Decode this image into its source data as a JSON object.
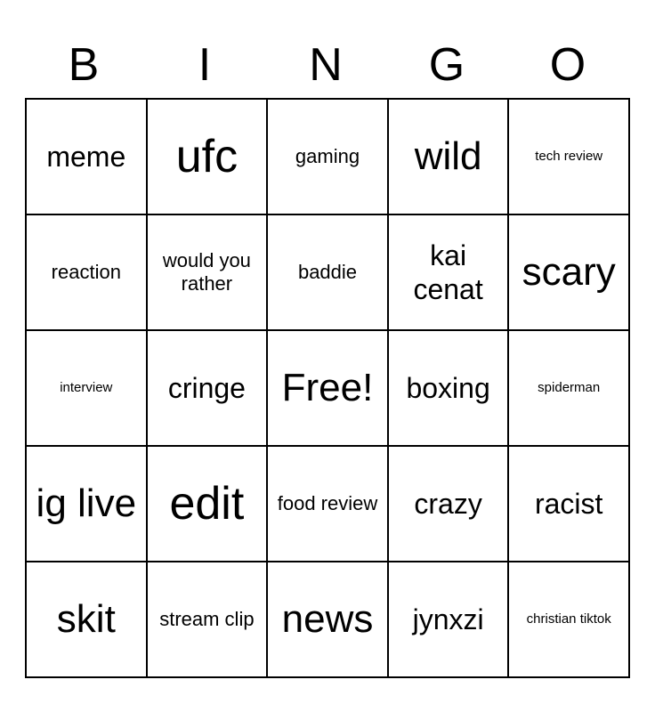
{
  "header": {
    "letters": [
      "B",
      "I",
      "N",
      "G",
      "O"
    ]
  },
  "grid": [
    [
      {
        "text": "meme",
        "size": "size-large"
      },
      {
        "text": "ufc",
        "size": "size-huge"
      },
      {
        "text": "gaming",
        "size": "size-medium"
      },
      {
        "text": "wild",
        "size": "size-xlarge"
      },
      {
        "text": "tech review",
        "size": "size-small"
      }
    ],
    [
      {
        "text": "reaction",
        "size": "size-medium"
      },
      {
        "text": "would you rather",
        "size": "size-medium"
      },
      {
        "text": "baddie",
        "size": "size-medium"
      },
      {
        "text": "kai cenat",
        "size": "size-large"
      },
      {
        "text": "scary",
        "size": "size-xlarge"
      }
    ],
    [
      {
        "text": "interview",
        "size": "size-small"
      },
      {
        "text": "cringe",
        "size": "size-large"
      },
      {
        "text": "Free!",
        "size": "size-xlarge"
      },
      {
        "text": "boxing",
        "size": "size-large"
      },
      {
        "text": "spiderman",
        "size": "size-small"
      }
    ],
    [
      {
        "text": "ig live",
        "size": "size-xlarge"
      },
      {
        "text": "edit",
        "size": "size-huge"
      },
      {
        "text": "food review",
        "size": "size-medium"
      },
      {
        "text": "crazy",
        "size": "size-large"
      },
      {
        "text": "racist",
        "size": "size-large"
      }
    ],
    [
      {
        "text": "skit",
        "size": "size-xlarge"
      },
      {
        "text": "stream clip",
        "size": "size-medium"
      },
      {
        "text": "news",
        "size": "size-xlarge"
      },
      {
        "text": "jynxzi",
        "size": "size-large"
      },
      {
        "text": "christian tiktok",
        "size": "size-small"
      }
    ]
  ]
}
